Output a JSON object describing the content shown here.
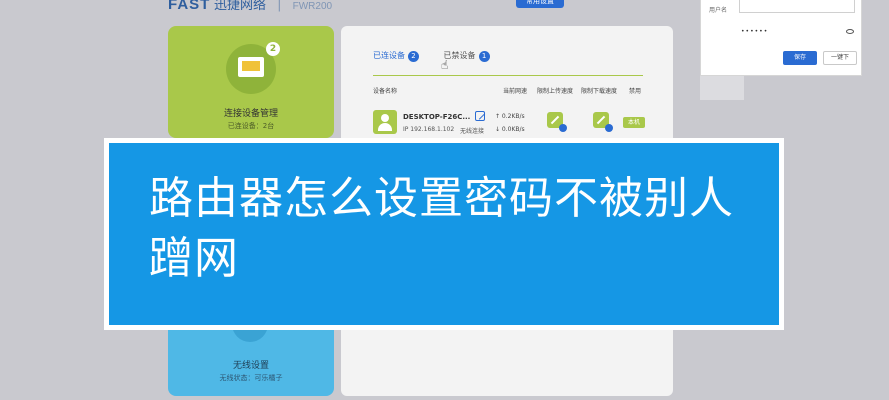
{
  "header": {
    "logo": "FAST",
    "brand_cn": "迅捷网络",
    "model": "FWR200",
    "top_button": "常用设置"
  },
  "left_cards": {
    "devices": {
      "title": "连接设备管理",
      "subtitle": "已连设备：2台",
      "badge": "2"
    },
    "wireless": {
      "title": "无线设置",
      "subtitle": "无线状态：可乐橘子"
    }
  },
  "panel": {
    "tabs": [
      {
        "label": "已连设备",
        "count": "2"
      },
      {
        "label": "已禁设备",
        "count": "1"
      }
    ],
    "columns": {
      "name": "设备名称",
      "speed": "当前网速",
      "upload_limit": "限制上传速度",
      "download_limit": "限制下载速度",
      "disable": "禁用"
    },
    "device": {
      "name": "DESKTOP-F26C...",
      "ip": "IP 192.168.1.102",
      "mac_label": "无线连接",
      "up_speed": "↑ 0.2KB/s",
      "down_speed": "↓ 0.0KB/s",
      "tag": "本机"
    }
  },
  "dialog": {
    "field_label": "用户名",
    "password_mask": "••••••",
    "save_label": "保存",
    "cancel_label": "一键下"
  },
  "banner": {
    "text": "路由器怎么设置密码不被别人蹭网"
  },
  "colors": {
    "accent_green": "#a9c84a",
    "brand_blue": "#2a6bd2",
    "banner_blue": "#1597e5",
    "wireless_blue": "#4fb8e6"
  }
}
